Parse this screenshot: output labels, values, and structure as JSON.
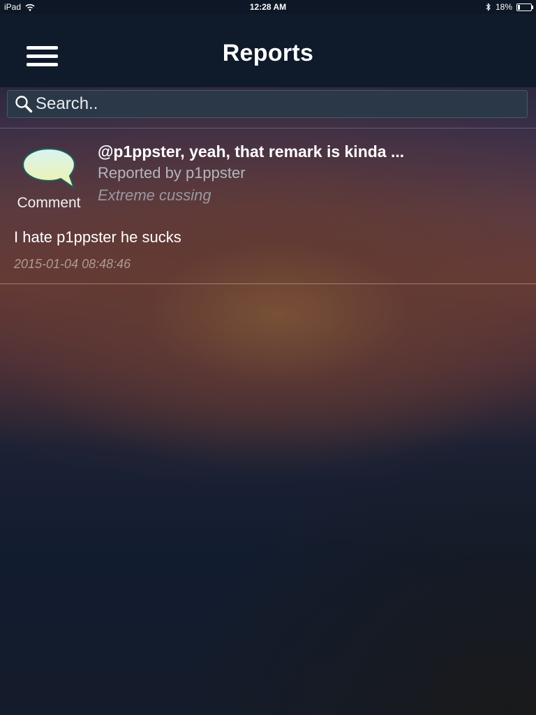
{
  "status_bar": {
    "device": "iPad",
    "time": "12:28 AM",
    "battery_text": "18%",
    "battery_level": 0.18,
    "icons": [
      "wifi-icon",
      "bluetooth-icon",
      "battery-icon"
    ]
  },
  "nav": {
    "title": "Reports",
    "menu_icon": "hamburger-menu-icon"
  },
  "search": {
    "placeholder": "Search..",
    "value": "",
    "icon": "search-icon"
  },
  "reports": [
    {
      "type": "Comment",
      "icon": "speech-bubble-icon",
      "title": "@p1ppster, yeah, that remark is kinda ...",
      "reported_by": "Reported by p1ppster",
      "reason": "Extreme cussing",
      "body": "I hate p1ppster he sucks",
      "date": "2015-01-04 08:48:46"
    }
  ],
  "colors": {
    "nav_background": "#0f1a2a",
    "search_background": "#2b3847",
    "bubble_fill_top": "#d8f4f2",
    "bubble_fill_bottom": "#f2f2a8",
    "bubble_outline": "#1f5c5a"
  }
}
